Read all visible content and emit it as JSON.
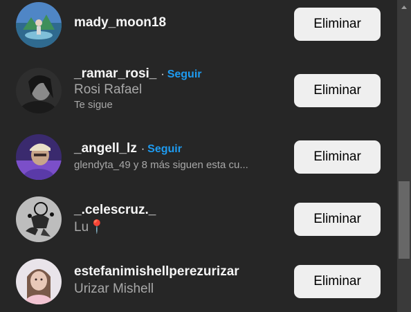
{
  "remove_label": "Eliminar",
  "follow_label": "Seguir",
  "separator": "·",
  "rows": [
    {
      "username": "mady_moon18",
      "full_name": "",
      "subtitle": "",
      "show_follow": false
    },
    {
      "username": "_ramar_rosi_",
      "full_name": "Rosi Rafael",
      "subtitle": "Te sigue",
      "show_follow": true
    },
    {
      "username": "_angell_lz",
      "full_name": "",
      "subtitle": "glendyta_49 y 8 más siguen esta cu...",
      "show_follow": true
    },
    {
      "username": "_.celescruz._",
      "full_name": "Lu📍",
      "subtitle": "",
      "show_follow": false
    },
    {
      "username": "estefanimishellperezurizar",
      "full_name": "Urizar Mishell",
      "subtitle": "",
      "show_follow": false
    }
  ],
  "scrollbar": {
    "arrow_icon": "scroll-up-arrow-icon"
  }
}
